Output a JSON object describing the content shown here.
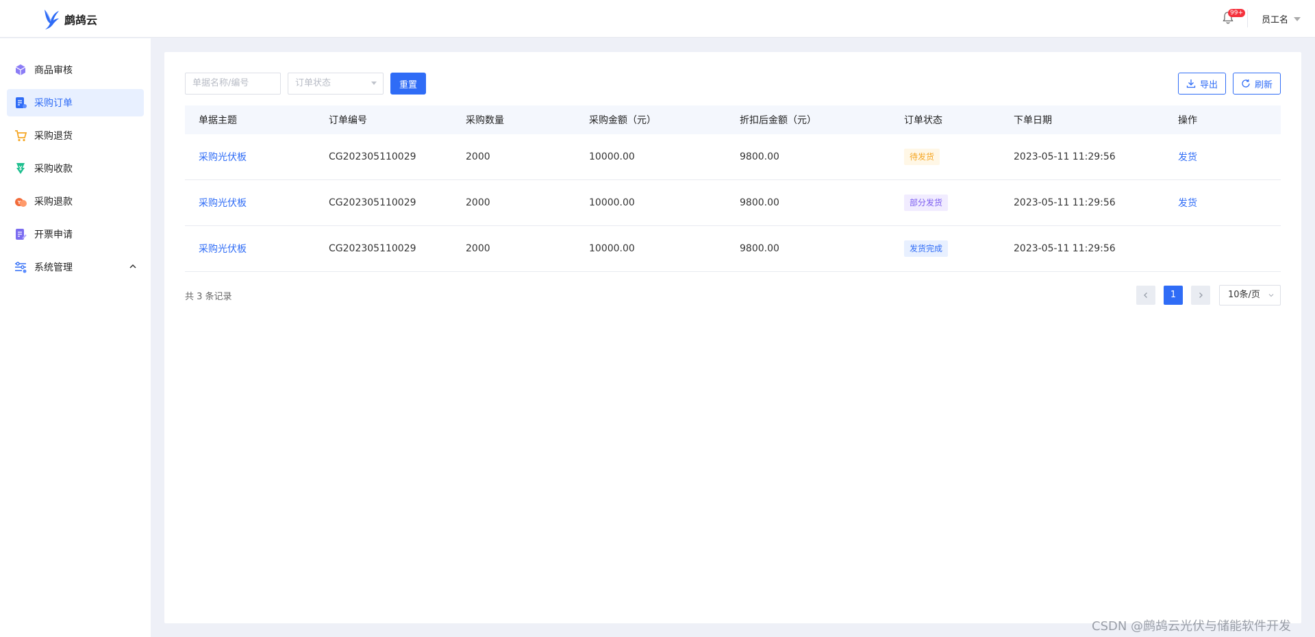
{
  "header": {
    "brand": "鹧鸪云",
    "notification_badge": "99+",
    "user_name": "员工名"
  },
  "sidebar": {
    "items": [
      {
        "label": "商品审核",
        "icon": "cube-icon",
        "active": false
      },
      {
        "label": "采购订单",
        "icon": "order-doc-icon",
        "active": true
      },
      {
        "label": "采购退货",
        "icon": "cart-return-icon",
        "active": false
      },
      {
        "label": "采购收款",
        "icon": "receive-money-icon",
        "active": false
      },
      {
        "label": "采购退款",
        "icon": "refund-icon",
        "active": false
      },
      {
        "label": "开票申请",
        "icon": "invoice-icon",
        "active": false
      },
      {
        "label": "系统管理",
        "icon": "settings-sliders-icon",
        "active": false
      }
    ]
  },
  "filters": {
    "search_placeholder": "单据名称/编号",
    "status_placeholder": "订单状态",
    "reset_label": "重置",
    "export_label": "导出",
    "refresh_label": "刷新"
  },
  "table": {
    "headers": [
      "单据主题",
      "订单编号",
      "采购数量",
      "采购金额（元）",
      "折扣后金额（元）",
      "订单状态",
      "下单日期",
      "操作"
    ],
    "rows": [
      {
        "subject": "采购光伏板",
        "order_no": "CG202305110029",
        "qty": "2000",
        "amount": "10000.00",
        "discounted": "9800.00",
        "status": "待发货",
        "status_type": "pending",
        "date": "2023-05-11 11:29:56",
        "action": "发货"
      },
      {
        "subject": "采购光伏板",
        "order_no": "CG202305110029",
        "qty": "2000",
        "amount": "10000.00",
        "discounted": "9800.00",
        "status": "部分发货",
        "status_type": "partial",
        "date": "2023-05-11 11:29:56",
        "action": "发货"
      },
      {
        "subject": "采购光伏板",
        "order_no": "CG202305110029",
        "qty": "2000",
        "amount": "10000.00",
        "discounted": "9800.00",
        "status": "发货完成",
        "status_type": "done",
        "date": "2023-05-11 11:29:56",
        "action": ""
      }
    ]
  },
  "pagination": {
    "total_text": "共 3 条记录",
    "current_page": "1",
    "page_size": "10条/页"
  },
  "watermark": "CSDN @鹧鸪云光伏与储能软件开发",
  "colors": {
    "primary": "#2f6cf6",
    "pending": "#f5a623",
    "partial": "#7b5cf0",
    "badge": "#f5313c"
  }
}
